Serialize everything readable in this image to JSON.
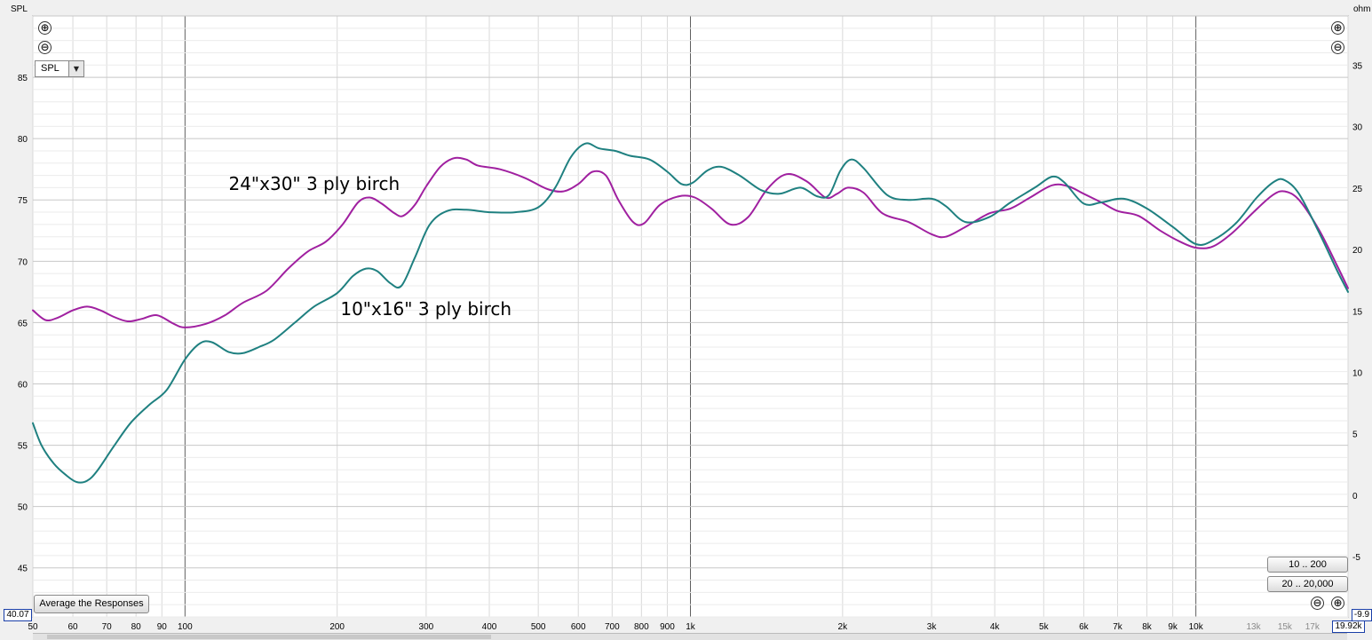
{
  "toolbar": {
    "zoom_in": "⊕",
    "zoom_out": "⊖",
    "y_measure": "SPL",
    "range_buttons": [
      "10 .. 200",
      "20 .. 20,000"
    ],
    "average_button": "Average the Responses",
    "readouts": {
      "left_value": "40.07",
      "right_value": "-9.9",
      "freq_value": "19.92k"
    }
  },
  "icons": {
    "zoom_in": "plus-circle-icon",
    "zoom_out": "minus-circle-icon",
    "dropdown": "chevron-down-icon"
  },
  "chart_data": {
    "type": "line",
    "xscale": "log",
    "xlim": [
      50,
      20000
    ],
    "ylim": [
      41,
      90
    ],
    "y2lim": [
      -9.9,
      39
    ],
    "ylabel": "SPL",
    "y2label": "ohm",
    "xticks": [
      {
        "v": 50,
        "l": "50"
      },
      {
        "v": 60,
        "l": "60"
      },
      {
        "v": 70,
        "l": "70"
      },
      {
        "v": 80,
        "l": "80"
      },
      {
        "v": 90,
        "l": "90"
      },
      {
        "v": 100,
        "l": "100"
      },
      {
        "v": 200,
        "l": "200"
      },
      {
        "v": 300,
        "l": "300"
      },
      {
        "v": 400,
        "l": "400"
      },
      {
        "v": 500,
        "l": "500"
      },
      {
        "v": 600,
        "l": "600"
      },
      {
        "v": 700,
        "l": "700"
      },
      {
        "v": 800,
        "l": "800"
      },
      {
        "v": 900,
        "l": "900"
      },
      {
        "v": 1000,
        "l": "1k"
      },
      {
        "v": 2000,
        "l": "2k"
      },
      {
        "v": 3000,
        "l": "3k"
      },
      {
        "v": 4000,
        "l": "4k"
      },
      {
        "v": 5000,
        "l": "5k"
      },
      {
        "v": 6000,
        "l": "6k"
      },
      {
        "v": 7000,
        "l": "7k"
      },
      {
        "v": 8000,
        "l": "8k"
      },
      {
        "v": 9000,
        "l": "9k"
      },
      {
        "v": 10000,
        "l": "10k"
      },
      {
        "v": 13000,
        "l": "13k"
      },
      {
        "v": 15000,
        "l": "15k"
      },
      {
        "v": 17000,
        "l": "17k"
      }
    ],
    "yticks": [
      45,
      50,
      55,
      60,
      65,
      70,
      75,
      80,
      85
    ],
    "y2ticks": [
      -5,
      0,
      5,
      10,
      15,
      20,
      25,
      30,
      35
    ],
    "grid": true,
    "series": [
      {
        "name": "24\"x30\" 3 ply birch",
        "color": "#a020a0",
        "points": [
          [
            50,
            66.0
          ],
          [
            53,
            65.2
          ],
          [
            56,
            65.4
          ],
          [
            60,
            66.0
          ],
          [
            64,
            66.3
          ],
          [
            68,
            66.0
          ],
          [
            72,
            65.5
          ],
          [
            77,
            65.1
          ],
          [
            82,
            65.3
          ],
          [
            88,
            65.6
          ],
          [
            95,
            64.9
          ],
          [
            100,
            64.6
          ],
          [
            110,
            64.9
          ],
          [
            120,
            65.6
          ],
          [
            130,
            66.6
          ],
          [
            145,
            67.6
          ],
          [
            160,
            69.4
          ],
          [
            175,
            70.8
          ],
          [
            190,
            71.6
          ],
          [
            205,
            73.0
          ],
          [
            220,
            74.8
          ],
          [
            232,
            75.2
          ],
          [
            245,
            74.7
          ],
          [
            260,
            73.9
          ],
          [
            270,
            73.7
          ],
          [
            285,
            74.6
          ],
          [
            300,
            76.1
          ],
          [
            320,
            77.7
          ],
          [
            340,
            78.4
          ],
          [
            360,
            78.3
          ],
          [
            380,
            77.8
          ],
          [
            420,
            77.5
          ],
          [
            470,
            76.8
          ],
          [
            520,
            75.9
          ],
          [
            560,
            75.7
          ],
          [
            600,
            76.3
          ],
          [
            640,
            77.3
          ],
          [
            680,
            77.0
          ],
          [
            720,
            75.0
          ],
          [
            770,
            73.2
          ],
          [
            810,
            73.1
          ],
          [
            870,
            74.6
          ],
          [
            950,
            75.3
          ],
          [
            1020,
            75.2
          ],
          [
            1100,
            74.3
          ],
          [
            1200,
            73.0
          ],
          [
            1300,
            73.6
          ],
          [
            1420,
            75.9
          ],
          [
            1550,
            77.1
          ],
          [
            1700,
            76.5
          ],
          [
            1850,
            75.2
          ],
          [
            1950,
            75.5
          ],
          [
            2050,
            76.0
          ],
          [
            2200,
            75.6
          ],
          [
            2400,
            73.9
          ],
          [
            2700,
            73.2
          ],
          [
            3000,
            72.2
          ],
          [
            3200,
            72.0
          ],
          [
            3500,
            72.8
          ],
          [
            3900,
            73.9
          ],
          [
            4300,
            74.3
          ],
          [
            4700,
            75.2
          ],
          [
            5200,
            76.2
          ],
          [
            5600,
            76.1
          ],
          [
            6000,
            75.5
          ],
          [
            6500,
            74.8
          ],
          [
            7000,
            74.1
          ],
          [
            7700,
            73.7
          ],
          [
            8500,
            72.5
          ],
          [
            9300,
            71.6
          ],
          [
            10000,
            71.1
          ],
          [
            10800,
            71.2
          ],
          [
            11800,
            72.3
          ],
          [
            13000,
            74.0
          ],
          [
            14200,
            75.4
          ],
          [
            15000,
            75.7
          ],
          [
            16000,
            75.0
          ],
          [
            17500,
            72.6
          ],
          [
            19000,
            69.7
          ],
          [
            20000,
            67.8
          ]
        ]
      },
      {
        "name": "10\"x16\" 3 ply birch",
        "color": "#1f8080",
        "points": [
          [
            50,
            56.8
          ],
          [
            52,
            55.0
          ],
          [
            55,
            53.5
          ],
          [
            58,
            52.6
          ],
          [
            61,
            52.0
          ],
          [
            64,
            52.1
          ],
          [
            67,
            52.9
          ],
          [
            72,
            54.8
          ],
          [
            78,
            56.8
          ],
          [
            85,
            58.3
          ],
          [
            92,
            59.5
          ],
          [
            100,
            62.0
          ],
          [
            107,
            63.3
          ],
          [
            113,
            63.4
          ],
          [
            122,
            62.6
          ],
          [
            130,
            62.5
          ],
          [
            140,
            63.0
          ],
          [
            150,
            63.6
          ],
          [
            165,
            65.0
          ],
          [
            180,
            66.3
          ],
          [
            200,
            67.4
          ],
          [
            215,
            68.8
          ],
          [
            228,
            69.4
          ],
          [
            240,
            69.2
          ],
          [
            255,
            68.2
          ],
          [
            268,
            68.0
          ],
          [
            285,
            70.3
          ],
          [
            305,
            73.0
          ],
          [
            330,
            74.1
          ],
          [
            360,
            74.2
          ],
          [
            400,
            74.0
          ],
          [
            450,
            74.0
          ],
          [
            500,
            74.4
          ],
          [
            540,
            76.0
          ],
          [
            580,
            78.5
          ],
          [
            620,
            79.6
          ],
          [
            660,
            79.2
          ],
          [
            710,
            79.0
          ],
          [
            760,
            78.6
          ],
          [
            830,
            78.3
          ],
          [
            900,
            77.3
          ],
          [
            960,
            76.3
          ],
          [
            1010,
            76.4
          ],
          [
            1080,
            77.4
          ],
          [
            1150,
            77.7
          ],
          [
            1250,
            77.0
          ],
          [
            1380,
            75.8
          ],
          [
            1500,
            75.5
          ],
          [
            1650,
            76.0
          ],
          [
            1780,
            75.3
          ],
          [
            1880,
            75.4
          ],
          [
            1980,
            77.4
          ],
          [
            2080,
            78.3
          ],
          [
            2200,
            77.6
          ],
          [
            2450,
            75.4
          ],
          [
            2700,
            75.0
          ],
          [
            3000,
            75.1
          ],
          [
            3200,
            74.5
          ],
          [
            3500,
            73.2
          ],
          [
            3900,
            73.6
          ],
          [
            4300,
            74.8
          ],
          [
            4800,
            76.0
          ],
          [
            5200,
            76.9
          ],
          [
            5500,
            76.4
          ],
          [
            6000,
            74.7
          ],
          [
            6500,
            74.8
          ],
          [
            7200,
            75.1
          ],
          [
            8000,
            74.3
          ],
          [
            9000,
            72.8
          ],
          [
            10000,
            71.4
          ],
          [
            10800,
            71.7
          ],
          [
            12000,
            73.1
          ],
          [
            13200,
            75.2
          ],
          [
            14300,
            76.5
          ],
          [
            15000,
            76.6
          ],
          [
            16000,
            75.5
          ],
          [
            17500,
            72.4
          ],
          [
            19000,
            69.3
          ],
          [
            20000,
            67.5
          ]
        ]
      }
    ],
    "annotations": [
      {
        "text": "24\"x30\" 3 ply birch",
        "x": 122,
        "y": 75.8
      },
      {
        "text": "10\"x16\" 3 ply birch",
        "x": 203,
        "y": 65.6
      }
    ]
  }
}
